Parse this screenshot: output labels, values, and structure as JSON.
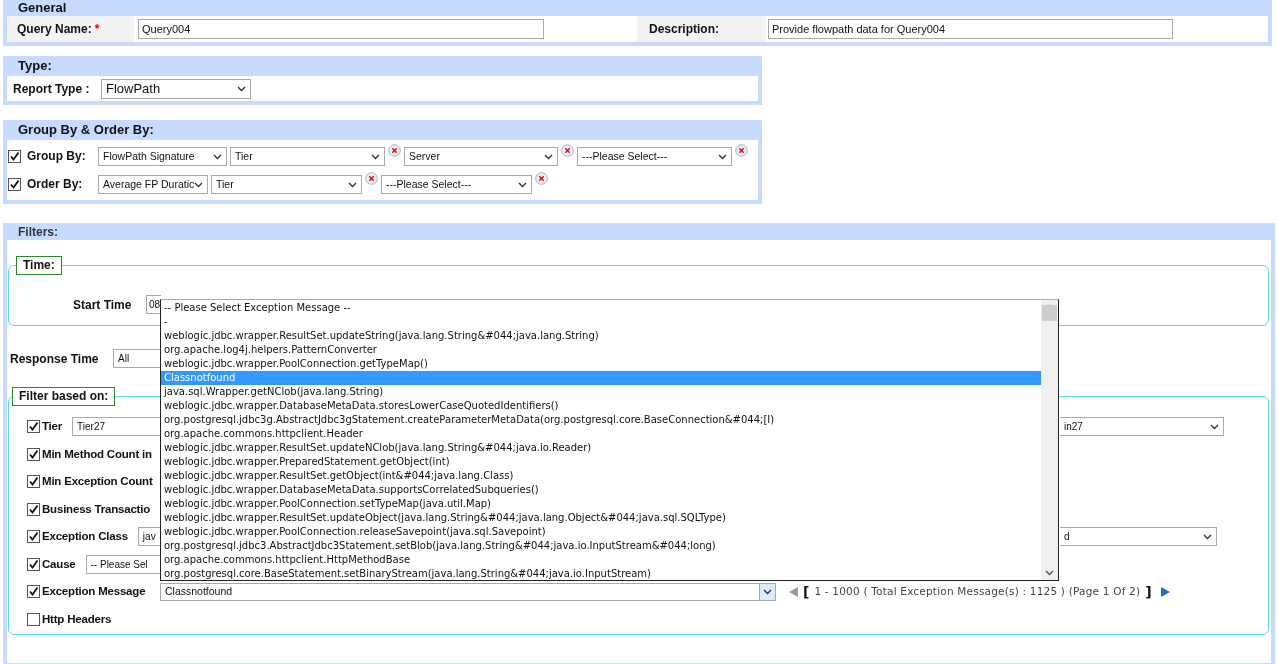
{
  "general": {
    "title": "General",
    "query_name": {
      "label": "Query Name:",
      "required_mark": "*",
      "value": "Query004"
    },
    "description": {
      "label": "Description:",
      "value": "Provide flowpath data for Query004"
    }
  },
  "type": {
    "title": "Type:",
    "report_type": {
      "label": "Report Type :",
      "value": "FlowPath"
    }
  },
  "group_order": {
    "title": "Group By & Order By:",
    "rows": [
      {
        "label": "Group By:",
        "checked": true,
        "selects": [
          {
            "value": "FlowPath Signature",
            "removable": false
          },
          {
            "value": "Tier",
            "removable": true
          },
          {
            "value": "Server",
            "removable": true
          },
          {
            "value": "---Please Select---",
            "removable": true
          }
        ]
      },
      {
        "label": "Order By:",
        "checked": true,
        "selects": [
          {
            "value": "Average FP Duratic",
            "removable": false
          },
          {
            "value": "Tier",
            "removable": true
          },
          {
            "value": "---Please Select---",
            "removable": true
          }
        ]
      }
    ]
  },
  "filters": {
    "title": "Filters:",
    "time": {
      "legend": "Time:",
      "start_time": {
        "label": "Start Time",
        "value": "08"
      }
    },
    "response_time": {
      "label": "Response Time",
      "value": "All"
    },
    "filter_based_on": {
      "legend": "Filter based on:",
      "rows": [
        {
          "kind": "select_pair",
          "label": "Tier",
          "checked": true,
          "value": "Tier27",
          "value_2": "in27"
        },
        {
          "kind": "label_only",
          "label": "Min Method Count in",
          "checked": true
        },
        {
          "kind": "label_only",
          "label": "Min Exception Count",
          "checked": true
        },
        {
          "kind": "label_only",
          "label": "Business Transactio",
          "checked": true
        },
        {
          "kind": "select_pair",
          "label": "Exception Class",
          "checked": true,
          "value": "jav",
          "value_2": "d"
        },
        {
          "kind": "select",
          "label": "Cause",
          "checked": true,
          "value": "-- Please Sel"
        },
        {
          "kind": "paged_select",
          "label": "Exception Message",
          "checked": true,
          "value": "Classnotfound"
        },
        {
          "kind": "label_only",
          "label": "Http Headers",
          "checked": false
        }
      ]
    },
    "pagination": {
      "prev_disabled": true,
      "bracket_open": "[",
      "text": "1 - 1000 ( Total Exception Message(s) : 1125 ) (Page 1 Of 2)",
      "bracket_close": "]",
      "next_disabled": false
    },
    "exception_list": {
      "options": [
        {
          "text": "-- Please Select Exception Message --",
          "selected": false
        },
        {
          "text": "-",
          "selected": false
        },
        {
          "text": "weblogic.jdbc.wrapper.ResultSet.updateString(java.lang.String&#044;java.lang.String)",
          "selected": false
        },
        {
          "text": "org.apache.log4j.helpers.PatternConverter",
          "selected": false
        },
        {
          "text": "weblogic.jdbc.wrapper.PoolConnection.getTypeMap()",
          "selected": false
        },
        {
          "text": "Classnotfound",
          "selected": true
        },
        {
          "text": "java.sql.Wrapper.getNClob(java.lang.String)",
          "selected": false
        },
        {
          "text": "weblogic.jdbc.wrapper.DatabaseMetaData.storesLowerCaseQuotedIdentifiers()",
          "selected": false
        },
        {
          "text": "org.postgresql.jdbc3g.AbstractJdbc3gStatement.createParameterMetaData(org.postgresql.core.BaseConnection&#044;[I)",
          "selected": false
        },
        {
          "text": "org.apache.commons.httpclient.Header",
          "selected": false
        },
        {
          "text": "weblogic.jdbc.wrapper.ResultSet.updateNClob(java.lang.String&#044;java.io.Reader)",
          "selected": false
        },
        {
          "text": "weblogic.jdbc.wrapper.PreparedStatement.getObject(int)",
          "selected": false
        },
        {
          "text": "weblogic.jdbc.wrapper.ResultSet.getObject(int&#044;java.lang.Class)",
          "selected": false
        },
        {
          "text": "weblogic.jdbc.wrapper.DatabaseMetaData.supportsCorrelatedSubqueries()",
          "selected": false
        },
        {
          "text": "weblogic.jdbc.wrapper.PoolConnection.setTypeMap(java.util.Map)",
          "selected": false
        },
        {
          "text": "weblogic.jdbc.wrapper.ResultSet.updateObject(java.lang.String&#044;java.lang.Object&#044;java.sql.SQLType)",
          "selected": false
        },
        {
          "text": "weblogic.jdbc.wrapper.PoolConnection.releaseSavepoint(java.sql.Savepoint)",
          "selected": false
        },
        {
          "text": "org.postgresql.jdbc3.AbstractJdbc3Statement.setBlob(java.lang.String&#044;java.io.InputStream&#044;long)",
          "selected": false
        },
        {
          "text": "org.apache.commons.httpclient.HttpMethodBase",
          "selected": false
        },
        {
          "text": "org.postgresql.core.BaseStatement.setBinaryStream(java.lang.String&#044;java.io.InputStream)",
          "selected": false
        }
      ]
    }
  }
}
